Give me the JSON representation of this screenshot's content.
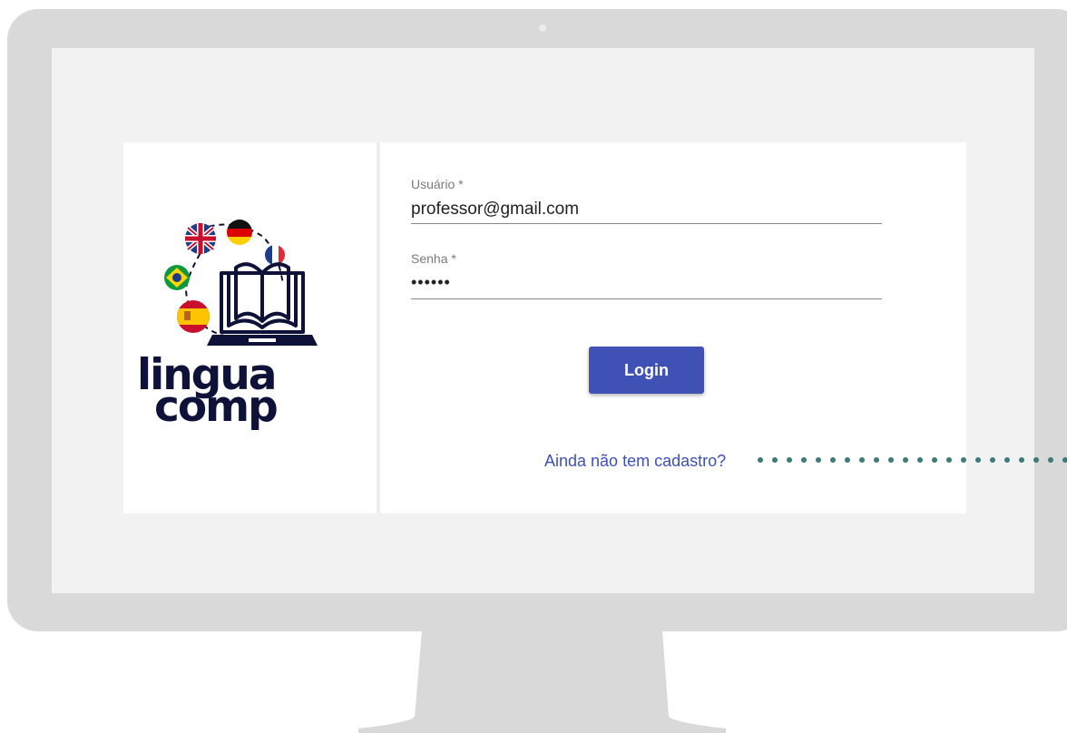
{
  "brand": {
    "logo_line1": "lingua",
    "logo_line2": "comp",
    "flags": [
      "uk-flag-icon",
      "germany-flag-icon",
      "france-flag-icon",
      "brazil-flag-icon",
      "spain-flag-icon"
    ]
  },
  "form": {
    "username_label": "Usuário *",
    "username_value": "professor@gmail.com",
    "password_label": "Senha *",
    "password_value": "••••••",
    "login_label": "Login",
    "signup_link": "Ainda não tem cadastro?"
  },
  "colors": {
    "primary": "#3f51b5",
    "monitor": "#d9d9d9",
    "screen_bg": "#f2f2f2",
    "logo_navy": "#0e1238",
    "annotation_dots": "#3e7b76"
  }
}
